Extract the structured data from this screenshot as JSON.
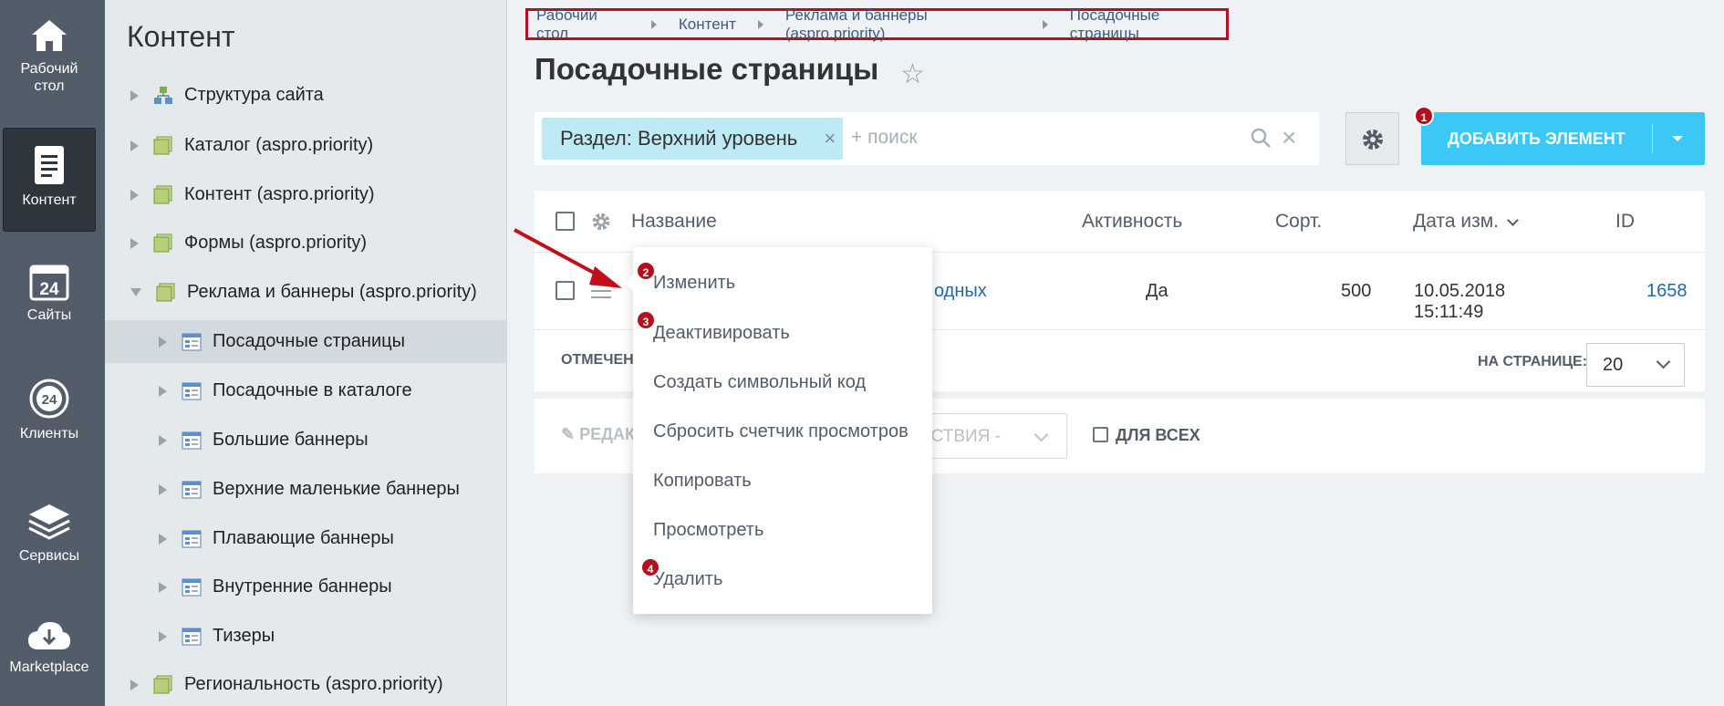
{
  "rail": [
    {
      "label": "Рабочий стол",
      "icon": "home-icon"
    },
    {
      "label": "Контент",
      "icon": "document-icon",
      "active": true
    },
    {
      "label": "Сайты",
      "icon": "calendar-24-icon"
    },
    {
      "label": "Клиенты",
      "icon": "clients-24-icon"
    },
    {
      "label": "Сервисы",
      "icon": "layers-icon"
    },
    {
      "label": "Marketplace",
      "icon": "cloud-download-icon"
    }
  ],
  "tree": {
    "title": "Контент",
    "items": [
      {
        "label": "Структура сайта"
      },
      {
        "label": "Каталог (aspro.priority)"
      },
      {
        "label": "Контент (aspro.priority)"
      },
      {
        "label": "Формы (aspro.priority)"
      },
      {
        "label": "Реклама и баннеры (aspro.priority)"
      },
      {
        "label": "Посадочные страницы"
      },
      {
        "label": "Посадочные в каталоге"
      },
      {
        "label": "Большие баннеры"
      },
      {
        "label": "Верхние маленькие баннеры"
      },
      {
        "label": "Плавающие баннеры"
      },
      {
        "label": "Внутренние баннеры"
      },
      {
        "label": "Тизеры"
      },
      {
        "label": "Региональность (aspro.priority)"
      }
    ]
  },
  "breadcrumbs": [
    "Рабочий стол",
    "Контент",
    "Реклама и баннеры (aspro.priority)",
    "Посадочные страницы"
  ],
  "page": {
    "title": "Посадочные страницы"
  },
  "filter": {
    "chip": "Раздел: Верхний уровень",
    "chip_close": "×",
    "placeholder": "+ поиск",
    "clear": "×"
  },
  "toolbar": {
    "add_label": "ДОБАВИТЬ ЭЛЕМЕНТ"
  },
  "badges": [
    "1",
    "2",
    "3",
    "4"
  ],
  "grid": {
    "columns": {
      "name": "Название",
      "active": "Активность",
      "sort": "Сорт.",
      "date": "Дата изм.",
      "id": "ID"
    },
    "row": {
      "name_visible": "одных",
      "active": "Да",
      "sort": "500",
      "date": "10.05.2018",
      "time": "15:11:49",
      "id": "1658"
    },
    "marked": "ОТМЕЧЕН",
    "per_page_label": "НА СТРАНИЦЕ:",
    "per_page_value": "20"
  },
  "actions": {
    "edit": "РЕДАК",
    "select": "ЙСТВИЯ -",
    "for_all": "ДЛЯ ВСЕХ"
  },
  "context_menu": [
    "Изменить",
    "Деактивировать",
    "Создать символьный код",
    "Сбросить счетчик просмотров",
    "Копировать",
    "Просмотреть",
    "Удалить"
  ],
  "colors": {
    "accent": "#3bc8f5",
    "annotation": "#b3121d",
    "rail": "#535c69"
  }
}
